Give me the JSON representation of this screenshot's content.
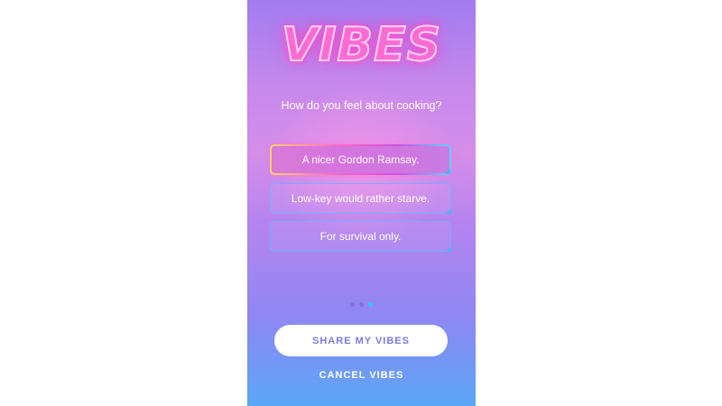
{
  "logo": "VIBES",
  "question": "How do you feel about cooking?",
  "answers": [
    {
      "label": "A nicer Gordon Ramsay.",
      "selected": true
    },
    {
      "label": "Low-key would rather starve.",
      "selected": false
    },
    {
      "label": "For survival only.",
      "selected": false
    }
  ],
  "pagination": {
    "total": 3,
    "current": 3
  },
  "share_button": "SHARE MY VIBES",
  "cancel_link": "CANCEL VIBES",
  "colors": {
    "gradient_top": "#a27cf0",
    "gradient_bottom": "#5aa6f7",
    "accent_blue": "#43b8ff",
    "share_text": "#7c7ce0"
  }
}
